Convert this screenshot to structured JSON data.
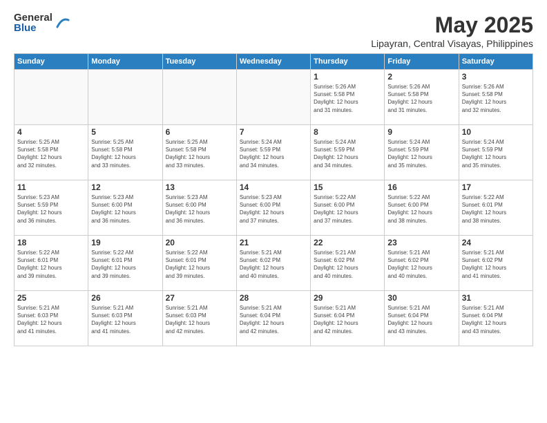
{
  "logo": {
    "general": "General",
    "blue": "Blue"
  },
  "title": "May 2025",
  "location": "Lipayran, Central Visayas, Philippines",
  "days_of_week": [
    "Sunday",
    "Monday",
    "Tuesday",
    "Wednesday",
    "Thursday",
    "Friday",
    "Saturday"
  ],
  "weeks": [
    [
      {
        "day": "",
        "info": ""
      },
      {
        "day": "",
        "info": ""
      },
      {
        "day": "",
        "info": ""
      },
      {
        "day": "",
        "info": ""
      },
      {
        "day": "1",
        "info": "Sunrise: 5:26 AM\nSunset: 5:58 PM\nDaylight: 12 hours\nand 31 minutes."
      },
      {
        "day": "2",
        "info": "Sunrise: 5:26 AM\nSunset: 5:58 PM\nDaylight: 12 hours\nand 31 minutes."
      },
      {
        "day": "3",
        "info": "Sunrise: 5:26 AM\nSunset: 5:58 PM\nDaylight: 12 hours\nand 32 minutes."
      }
    ],
    [
      {
        "day": "4",
        "info": "Sunrise: 5:25 AM\nSunset: 5:58 PM\nDaylight: 12 hours\nand 32 minutes."
      },
      {
        "day": "5",
        "info": "Sunrise: 5:25 AM\nSunset: 5:58 PM\nDaylight: 12 hours\nand 33 minutes."
      },
      {
        "day": "6",
        "info": "Sunrise: 5:25 AM\nSunset: 5:58 PM\nDaylight: 12 hours\nand 33 minutes."
      },
      {
        "day": "7",
        "info": "Sunrise: 5:24 AM\nSunset: 5:59 PM\nDaylight: 12 hours\nand 34 minutes."
      },
      {
        "day": "8",
        "info": "Sunrise: 5:24 AM\nSunset: 5:59 PM\nDaylight: 12 hours\nand 34 minutes."
      },
      {
        "day": "9",
        "info": "Sunrise: 5:24 AM\nSunset: 5:59 PM\nDaylight: 12 hours\nand 35 minutes."
      },
      {
        "day": "10",
        "info": "Sunrise: 5:24 AM\nSunset: 5:59 PM\nDaylight: 12 hours\nand 35 minutes."
      }
    ],
    [
      {
        "day": "11",
        "info": "Sunrise: 5:23 AM\nSunset: 5:59 PM\nDaylight: 12 hours\nand 36 minutes."
      },
      {
        "day": "12",
        "info": "Sunrise: 5:23 AM\nSunset: 6:00 PM\nDaylight: 12 hours\nand 36 minutes."
      },
      {
        "day": "13",
        "info": "Sunrise: 5:23 AM\nSunset: 6:00 PM\nDaylight: 12 hours\nand 36 minutes."
      },
      {
        "day": "14",
        "info": "Sunrise: 5:23 AM\nSunset: 6:00 PM\nDaylight: 12 hours\nand 37 minutes."
      },
      {
        "day": "15",
        "info": "Sunrise: 5:22 AM\nSunset: 6:00 PM\nDaylight: 12 hours\nand 37 minutes."
      },
      {
        "day": "16",
        "info": "Sunrise: 5:22 AM\nSunset: 6:00 PM\nDaylight: 12 hours\nand 38 minutes."
      },
      {
        "day": "17",
        "info": "Sunrise: 5:22 AM\nSunset: 6:01 PM\nDaylight: 12 hours\nand 38 minutes."
      }
    ],
    [
      {
        "day": "18",
        "info": "Sunrise: 5:22 AM\nSunset: 6:01 PM\nDaylight: 12 hours\nand 39 minutes."
      },
      {
        "day": "19",
        "info": "Sunrise: 5:22 AM\nSunset: 6:01 PM\nDaylight: 12 hours\nand 39 minutes."
      },
      {
        "day": "20",
        "info": "Sunrise: 5:22 AM\nSunset: 6:01 PM\nDaylight: 12 hours\nand 39 minutes."
      },
      {
        "day": "21",
        "info": "Sunrise: 5:21 AM\nSunset: 6:02 PM\nDaylight: 12 hours\nand 40 minutes."
      },
      {
        "day": "22",
        "info": "Sunrise: 5:21 AM\nSunset: 6:02 PM\nDaylight: 12 hours\nand 40 minutes."
      },
      {
        "day": "23",
        "info": "Sunrise: 5:21 AM\nSunset: 6:02 PM\nDaylight: 12 hours\nand 40 minutes."
      },
      {
        "day": "24",
        "info": "Sunrise: 5:21 AM\nSunset: 6:02 PM\nDaylight: 12 hours\nand 41 minutes."
      }
    ],
    [
      {
        "day": "25",
        "info": "Sunrise: 5:21 AM\nSunset: 6:03 PM\nDaylight: 12 hours\nand 41 minutes."
      },
      {
        "day": "26",
        "info": "Sunrise: 5:21 AM\nSunset: 6:03 PM\nDaylight: 12 hours\nand 41 minutes."
      },
      {
        "day": "27",
        "info": "Sunrise: 5:21 AM\nSunset: 6:03 PM\nDaylight: 12 hours\nand 42 minutes."
      },
      {
        "day": "28",
        "info": "Sunrise: 5:21 AM\nSunset: 6:04 PM\nDaylight: 12 hours\nand 42 minutes."
      },
      {
        "day": "29",
        "info": "Sunrise: 5:21 AM\nSunset: 6:04 PM\nDaylight: 12 hours\nand 42 minutes."
      },
      {
        "day": "30",
        "info": "Sunrise: 5:21 AM\nSunset: 6:04 PM\nDaylight: 12 hours\nand 43 minutes."
      },
      {
        "day": "31",
        "info": "Sunrise: 5:21 AM\nSunset: 6:04 PM\nDaylight: 12 hours\nand 43 minutes."
      }
    ]
  ]
}
